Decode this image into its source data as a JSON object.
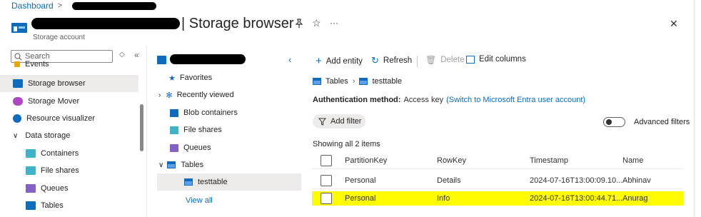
{
  "breadcrumb": {
    "home": "Dashboard",
    "sep": ">"
  },
  "header": {
    "title": "| Storage browser",
    "subtitle": "Storage account",
    "pin_icon": "pin-icon",
    "star_icon": "star-icon",
    "more_label": "···",
    "close_label": "✕"
  },
  "sidebar": {
    "search_placeholder": "Search",
    "items": [
      {
        "label": "Events",
        "icon": "events-icon",
        "color": "#e8a600"
      },
      {
        "label": "Storage browser",
        "icon": "storage-browser-icon",
        "color": "#0f6cbd"
      },
      {
        "label": "Storage Mover",
        "icon": "storage-mover-icon",
        "color": "#b146c2"
      },
      {
        "label": "Resource visualizer",
        "icon": "resource-visualizer-icon",
        "color": "#0f6cbd"
      },
      {
        "label": "Data storage",
        "icon": "chevron-down-icon"
      },
      {
        "label": "Containers",
        "icon": "containers-icon",
        "color": "#3fb3c9"
      },
      {
        "label": "File shares",
        "icon": "file-shares-icon",
        "color": "#3fb3c9"
      },
      {
        "label": "Queues",
        "icon": "queues-icon",
        "color": "#8661c5"
      },
      {
        "label": "Tables",
        "icon": "tables-icon",
        "color": "#0f6cbd"
      }
    ]
  },
  "tree": {
    "items": [
      {
        "label": "Favorites",
        "icon": "star-icon"
      },
      {
        "label": "Recently viewed",
        "icon": "gear-icon"
      },
      {
        "label": "Blob containers",
        "icon": "blob-containers-icon"
      },
      {
        "label": "File shares",
        "icon": "file-shares-icon"
      },
      {
        "label": "Queues",
        "icon": "queues-icon"
      },
      {
        "label": "Tables",
        "icon": "tables-icon"
      },
      {
        "label": "testtable",
        "icon": "table-icon"
      }
    ],
    "view_all": "View all"
  },
  "toolbar": {
    "add_entity": "Add entity",
    "refresh": "Refresh",
    "delete": "Delete",
    "edit_columns": "Edit columns"
  },
  "path": {
    "tables": "Tables",
    "table": "testtable"
  },
  "auth": {
    "label": "Authentication method:",
    "value": "Access key",
    "switch_link": "(Switch to Microsoft Entra user account)"
  },
  "filter": {
    "add_filter": "Add filter",
    "advanced": "Advanced filters"
  },
  "results": {
    "summary": "Showing all 2 items",
    "columns": [
      "PartitionKey",
      "RowKey",
      "Timestamp",
      "Name"
    ],
    "rows": [
      [
        "Personal",
        "Details",
        "2024-07-16T13:00:09.10...",
        "Abhinav"
      ],
      [
        "Personal",
        "Info",
        "2024-07-16T13:00:44.71...",
        "Anurag"
      ]
    ],
    "highlight_color": "#fffb00"
  }
}
